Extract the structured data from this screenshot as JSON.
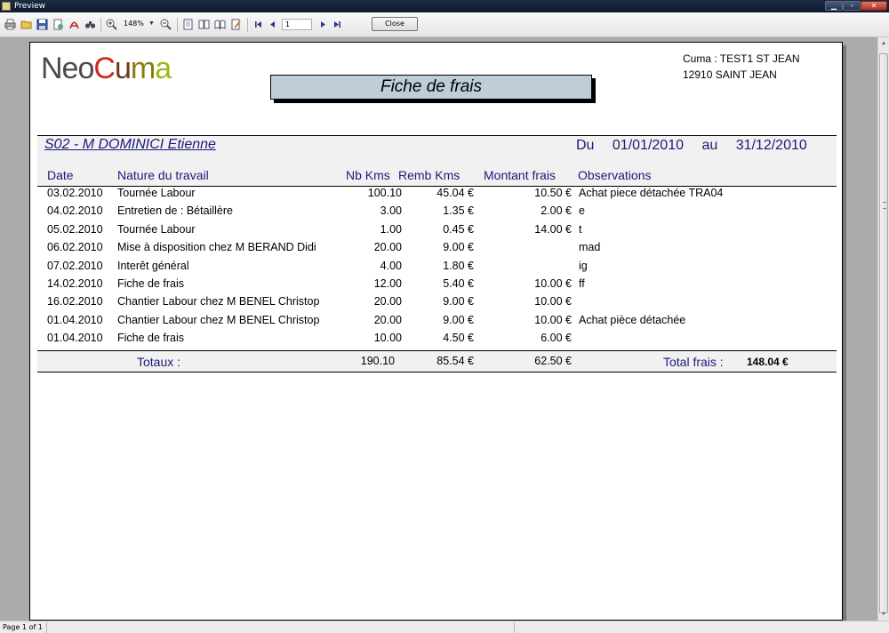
{
  "window": {
    "title": "Preview"
  },
  "toolbar": {
    "zoom": "148%",
    "page_number": "1",
    "close_label": "Close"
  },
  "status": {
    "page_text": "Page 1 of 1"
  },
  "document": {
    "logo": {
      "part1": "Neo",
      "part2_letters": [
        "C",
        "u",
        "m",
        "a"
      ],
      "part2_colors": [
        "#cc2a1c",
        "#6a3a1a",
        "#8a7a10",
        "#9ab81a"
      ]
    },
    "cuma_line1": "Cuma : TEST1  ST JEAN",
    "cuma_line2": "12910  SAINT JEAN",
    "title": "Fiche de frais",
    "person": "S02 - M DOMINICI Etienne",
    "period_du": "Du",
    "period_from": "01/01/2010",
    "period_au": "au",
    "period_to": "31/12/2010",
    "columns": {
      "date": "Date",
      "nature": "Nature du travail",
      "kms": "Nb Kms",
      "remb": "Remb Kms",
      "montant": "Montant frais",
      "obs": "Observations"
    },
    "rows": [
      {
        "date": "03.02.2010",
        "nature": "Tournée Labour",
        "kms": "100.10",
        "remb": "45.04 €",
        "montant": "10.50 €",
        "obs": "Achat piece détachée TRA04"
      },
      {
        "date": "04.02.2010",
        "nature": "Entretien de : Bétaillère",
        "kms": "3.00",
        "remb": "1.35 €",
        "montant": "2.00 €",
        "obs": "e"
      },
      {
        "date": "05.02.2010",
        "nature": "Tournée Labour",
        "kms": "1.00",
        "remb": "0.45 €",
        "montant": "14.00 €",
        "obs": "t"
      },
      {
        "date": "06.02.2010",
        "nature": "Mise à disposition chez M BERAND Didi",
        "kms": "20.00",
        "remb": "9.00 €",
        "montant": "",
        "obs": "mad"
      },
      {
        "date": "07.02.2010",
        "nature": "Interêt général",
        "kms": "4.00",
        "remb": "1.80 €",
        "montant": "",
        "obs": "ig"
      },
      {
        "date": "14.02.2010",
        "nature": "Fiche de frais",
        "kms": "12.00",
        "remb": "5.40 €",
        "montant": "10.00 €",
        "obs": "ff"
      },
      {
        "date": "16.02.2010",
        "nature": "Chantier Labour chez M BENEL Christop",
        "kms": "20.00",
        "remb": "9.00 €",
        "montant": "10.00 €",
        "obs": ""
      },
      {
        "date": "01.04.2010",
        "nature": "Chantier Labour chez M BENEL Christop",
        "kms": "20.00",
        "remb": "9.00 €",
        "montant": "10.00 €",
        "obs": "Achat pièce détachée"
      },
      {
        "date": "01.04.2010",
        "nature": "Fiche de frais",
        "kms": "10.00",
        "remb": "4.50 €",
        "montant": "6.00 €",
        "obs": ""
      }
    ],
    "totals": {
      "label": "Totaux :",
      "kms": "190.10",
      "remb": "85.54 €",
      "montant": "62.50 €",
      "frais_label": "Total frais :",
      "frais": "148.04 €"
    }
  }
}
